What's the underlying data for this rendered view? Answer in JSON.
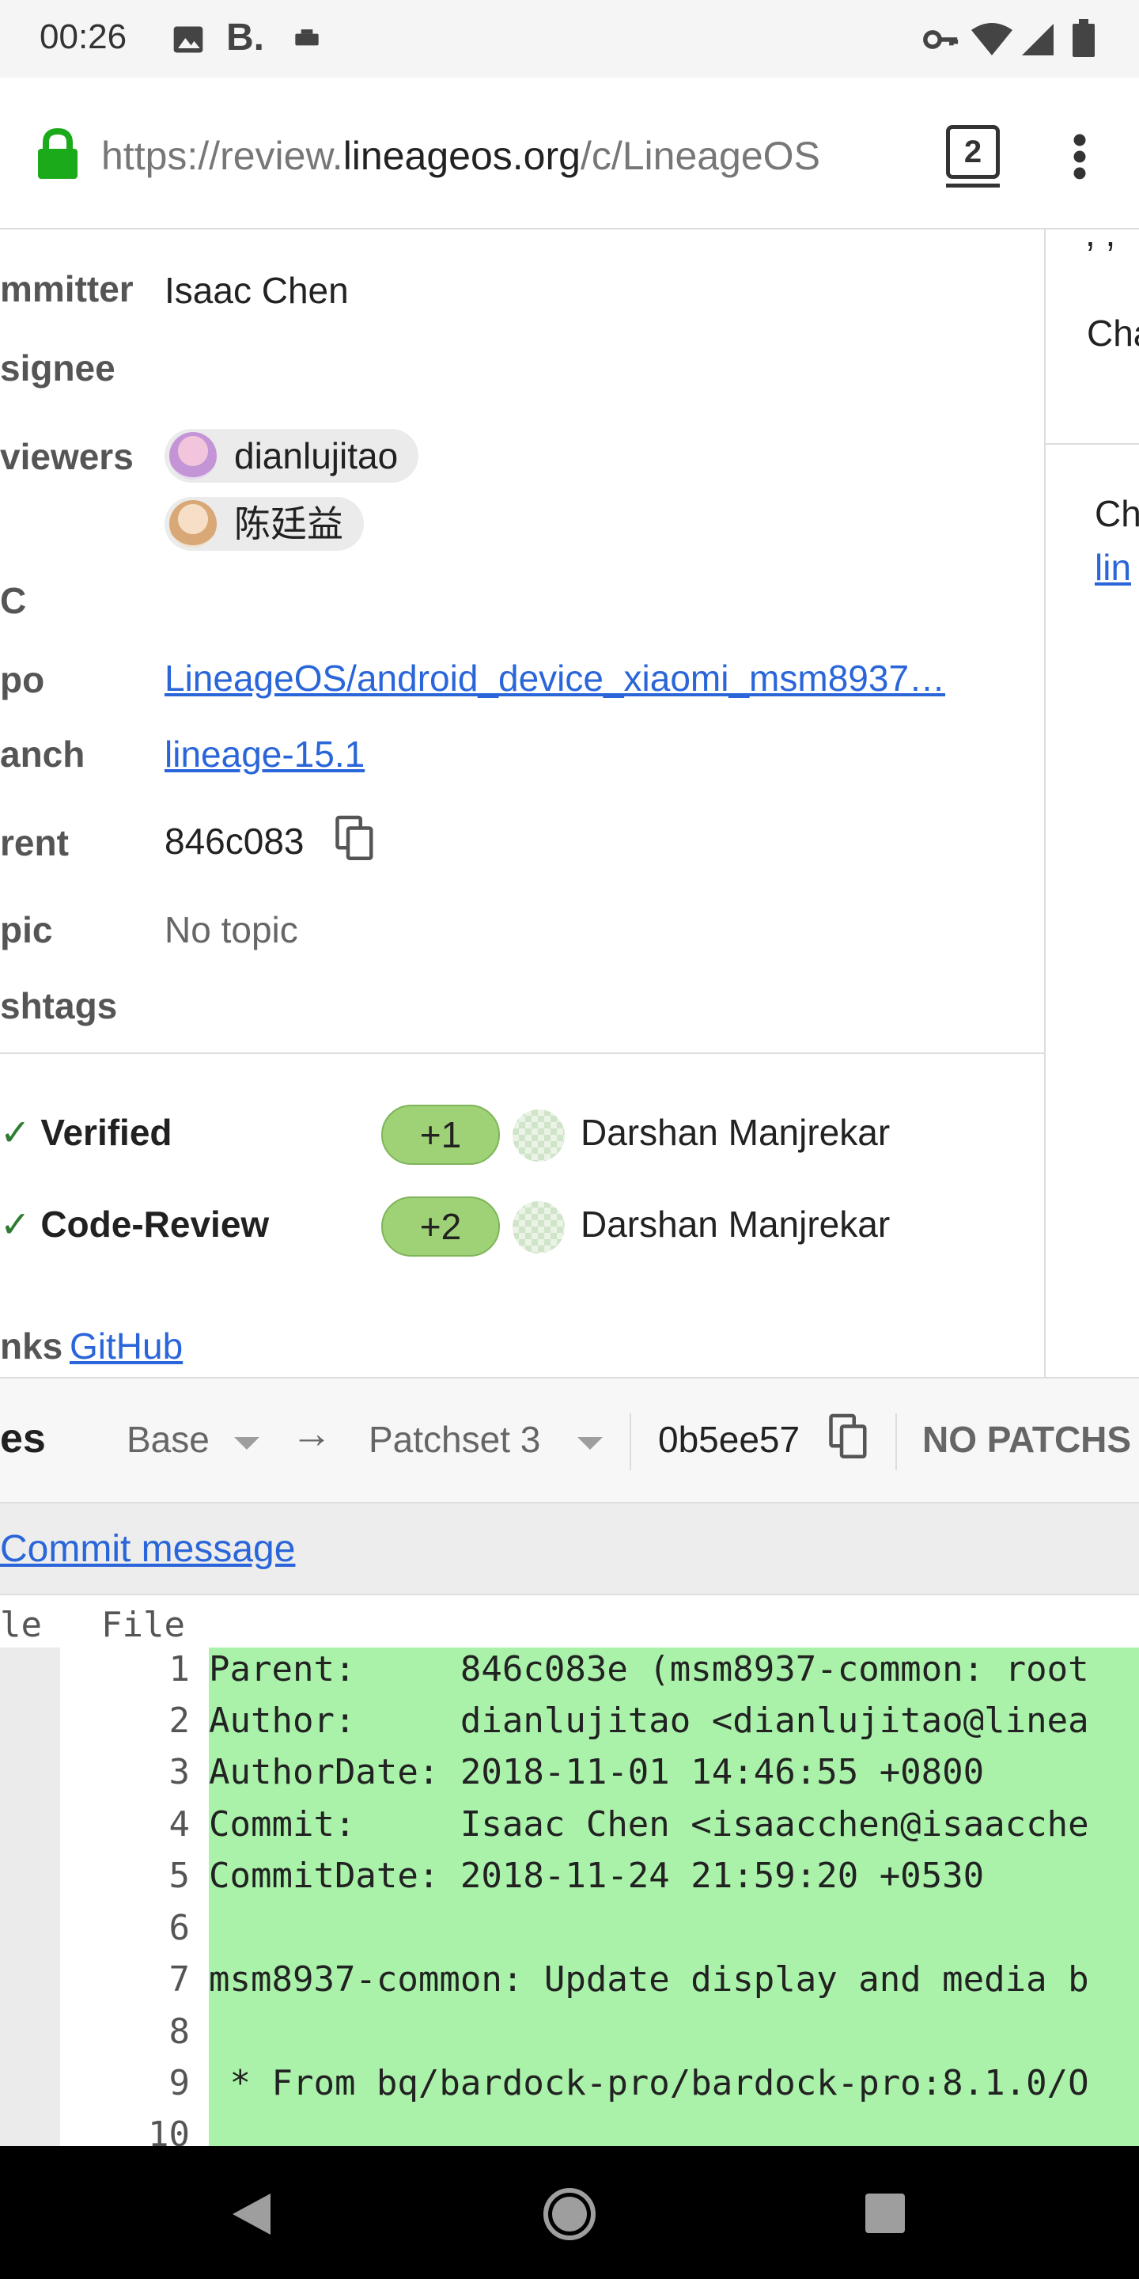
{
  "status_bar": {
    "time": "00:26",
    "notification_icons": [
      "image-icon",
      "b-icon",
      "usb-icon"
    ],
    "system_icons": [
      "key-icon",
      "wifi-icon",
      "signal-icon",
      "battery-icon"
    ]
  },
  "browser": {
    "url_prefix": "https://review.",
    "url_domain": "lineageos.org",
    "url_suffix": "/c/LineageOS",
    "tab_count": "2"
  },
  "change_info": {
    "committer_label": "mmitter",
    "committer_value": "Isaac Chen",
    "assignee_label": "signee",
    "reviewers_label": "viewers",
    "reviewers": [
      "dianlujitao",
      "陈廷益"
    ],
    "cc_label": "C",
    "repo_label": "po",
    "repo_value": "LineageOS/android_device_xiaomi_msm8937…",
    "branch_label": "anch",
    "branch_value": "lineage-15.1",
    "parent_label": "rent",
    "parent_value": "846c083",
    "topic_label": "pic",
    "topic_value": "No topic",
    "hashtags_label": "shtags"
  },
  "labels": [
    {
      "name": "Verified",
      "vote": "+1",
      "voter": "Darshan Manjrekar"
    },
    {
      "name": "Code-Review",
      "vote": "+2",
      "voter": "Darshan Manjrekar"
    }
  ],
  "links": {
    "label": "nks",
    "github": "GitHub"
  },
  "right_panel": {
    "top_text": ", ,",
    "item1": "Cha",
    "item2": "Ch",
    "item2_link": "lin"
  },
  "files_header": {
    "title": "es",
    "base": "Base",
    "arrow": "→",
    "patchset": "Patchset 3",
    "hash": "0b5ee57",
    "no_patch": "NO PATCHS"
  },
  "commit_message_link": "Commit message",
  "diff": {
    "left_header": "le",
    "right_header": "File",
    "lines": [
      {
        "n": "1",
        "text": "Parent:     846c083e (msm8937-common: root"
      },
      {
        "n": "2",
        "text": "Author:     dianlujitao <dianlujitao@linea"
      },
      {
        "n": "3",
        "text": "AuthorDate: 2018-11-01 14:46:55 +0800"
      },
      {
        "n": "4",
        "text": "Commit:     Isaac Chen <isaacchen@isaacche"
      },
      {
        "n": "5",
        "text": "CommitDate: 2018-11-24 21:59:20 +0530"
      },
      {
        "n": "6",
        "text": ""
      },
      {
        "n": "7",
        "text": "msm8937-common: Update display and media b"
      },
      {
        "n": "8",
        "text": ""
      },
      {
        "n": "9",
        "text": " * From bq/bardock-pro/bardock-pro:8.1.0/O"
      },
      {
        "n": "10",
        "text": ""
      }
    ]
  },
  "colors": {
    "link": "#2a66d9",
    "vote_bg": "#9fd276",
    "diff_added": "#aaf2aa",
    "lock": "#1aaa1a"
  }
}
